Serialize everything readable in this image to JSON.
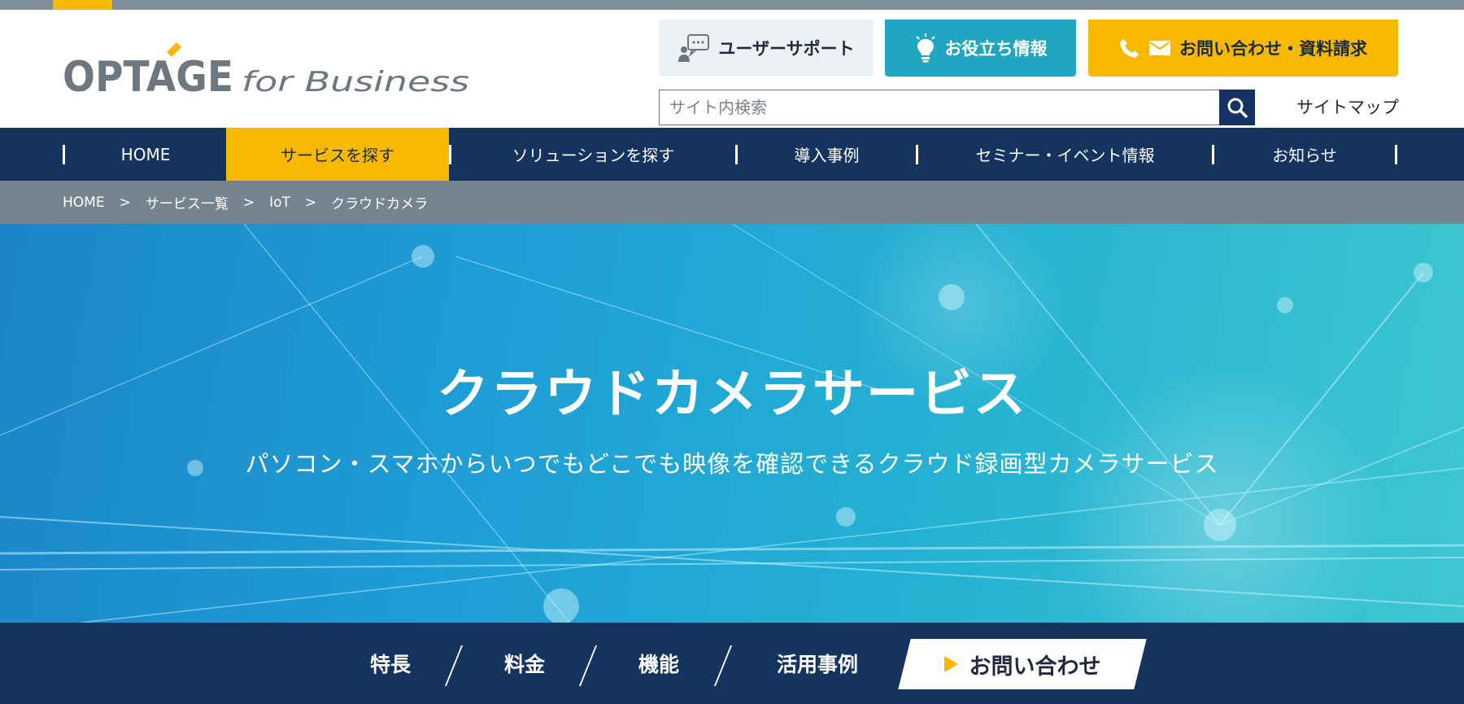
{
  "colors": {
    "brand_navy": "#15335f",
    "accent_yellow": "#f6b900",
    "accent_teal": "#20a6c1",
    "breadcrumb_gray": "#75848e",
    "logo_gray": "#6d7780"
  },
  "logo": {
    "main": "OPTAGE",
    "sub": "for Business"
  },
  "header": {
    "support_label": "ユーザーサポート",
    "support_icon": "chat-user-icon",
    "tips_label": "お役立ち情報",
    "tips_icon": "lightbulb-icon",
    "contact_label": "お問い合わせ・資料請求",
    "contact_icons": [
      "phone-icon",
      "mail-icon"
    ],
    "search_placeholder": "サイト内検索",
    "search_icon": "search-icon",
    "sitemap_label": "サイトマップ"
  },
  "gnav": {
    "items": [
      {
        "label": "HOME"
      },
      {
        "label": "サービスを探す",
        "active": true
      },
      {
        "label": "ソリューションを探す"
      },
      {
        "label": "導入事例"
      },
      {
        "label": "セミナー・イベント情報"
      },
      {
        "label": "お知らせ"
      }
    ]
  },
  "breadcrumb": {
    "items": [
      "HOME",
      "サービス一覧",
      "IoT",
      "クラウドカメラ"
    ],
    "separator": ">"
  },
  "hero": {
    "title": "クラウドカメラサービス",
    "subtitle": "パソコン・スマホからいつでもどこでも映像を確認できるクラウド録画型カメラサービス"
  },
  "anchor_nav": {
    "links": [
      "特長",
      "料金",
      "機能",
      "活用事例"
    ],
    "cta_label": "お問い合わせ"
  }
}
